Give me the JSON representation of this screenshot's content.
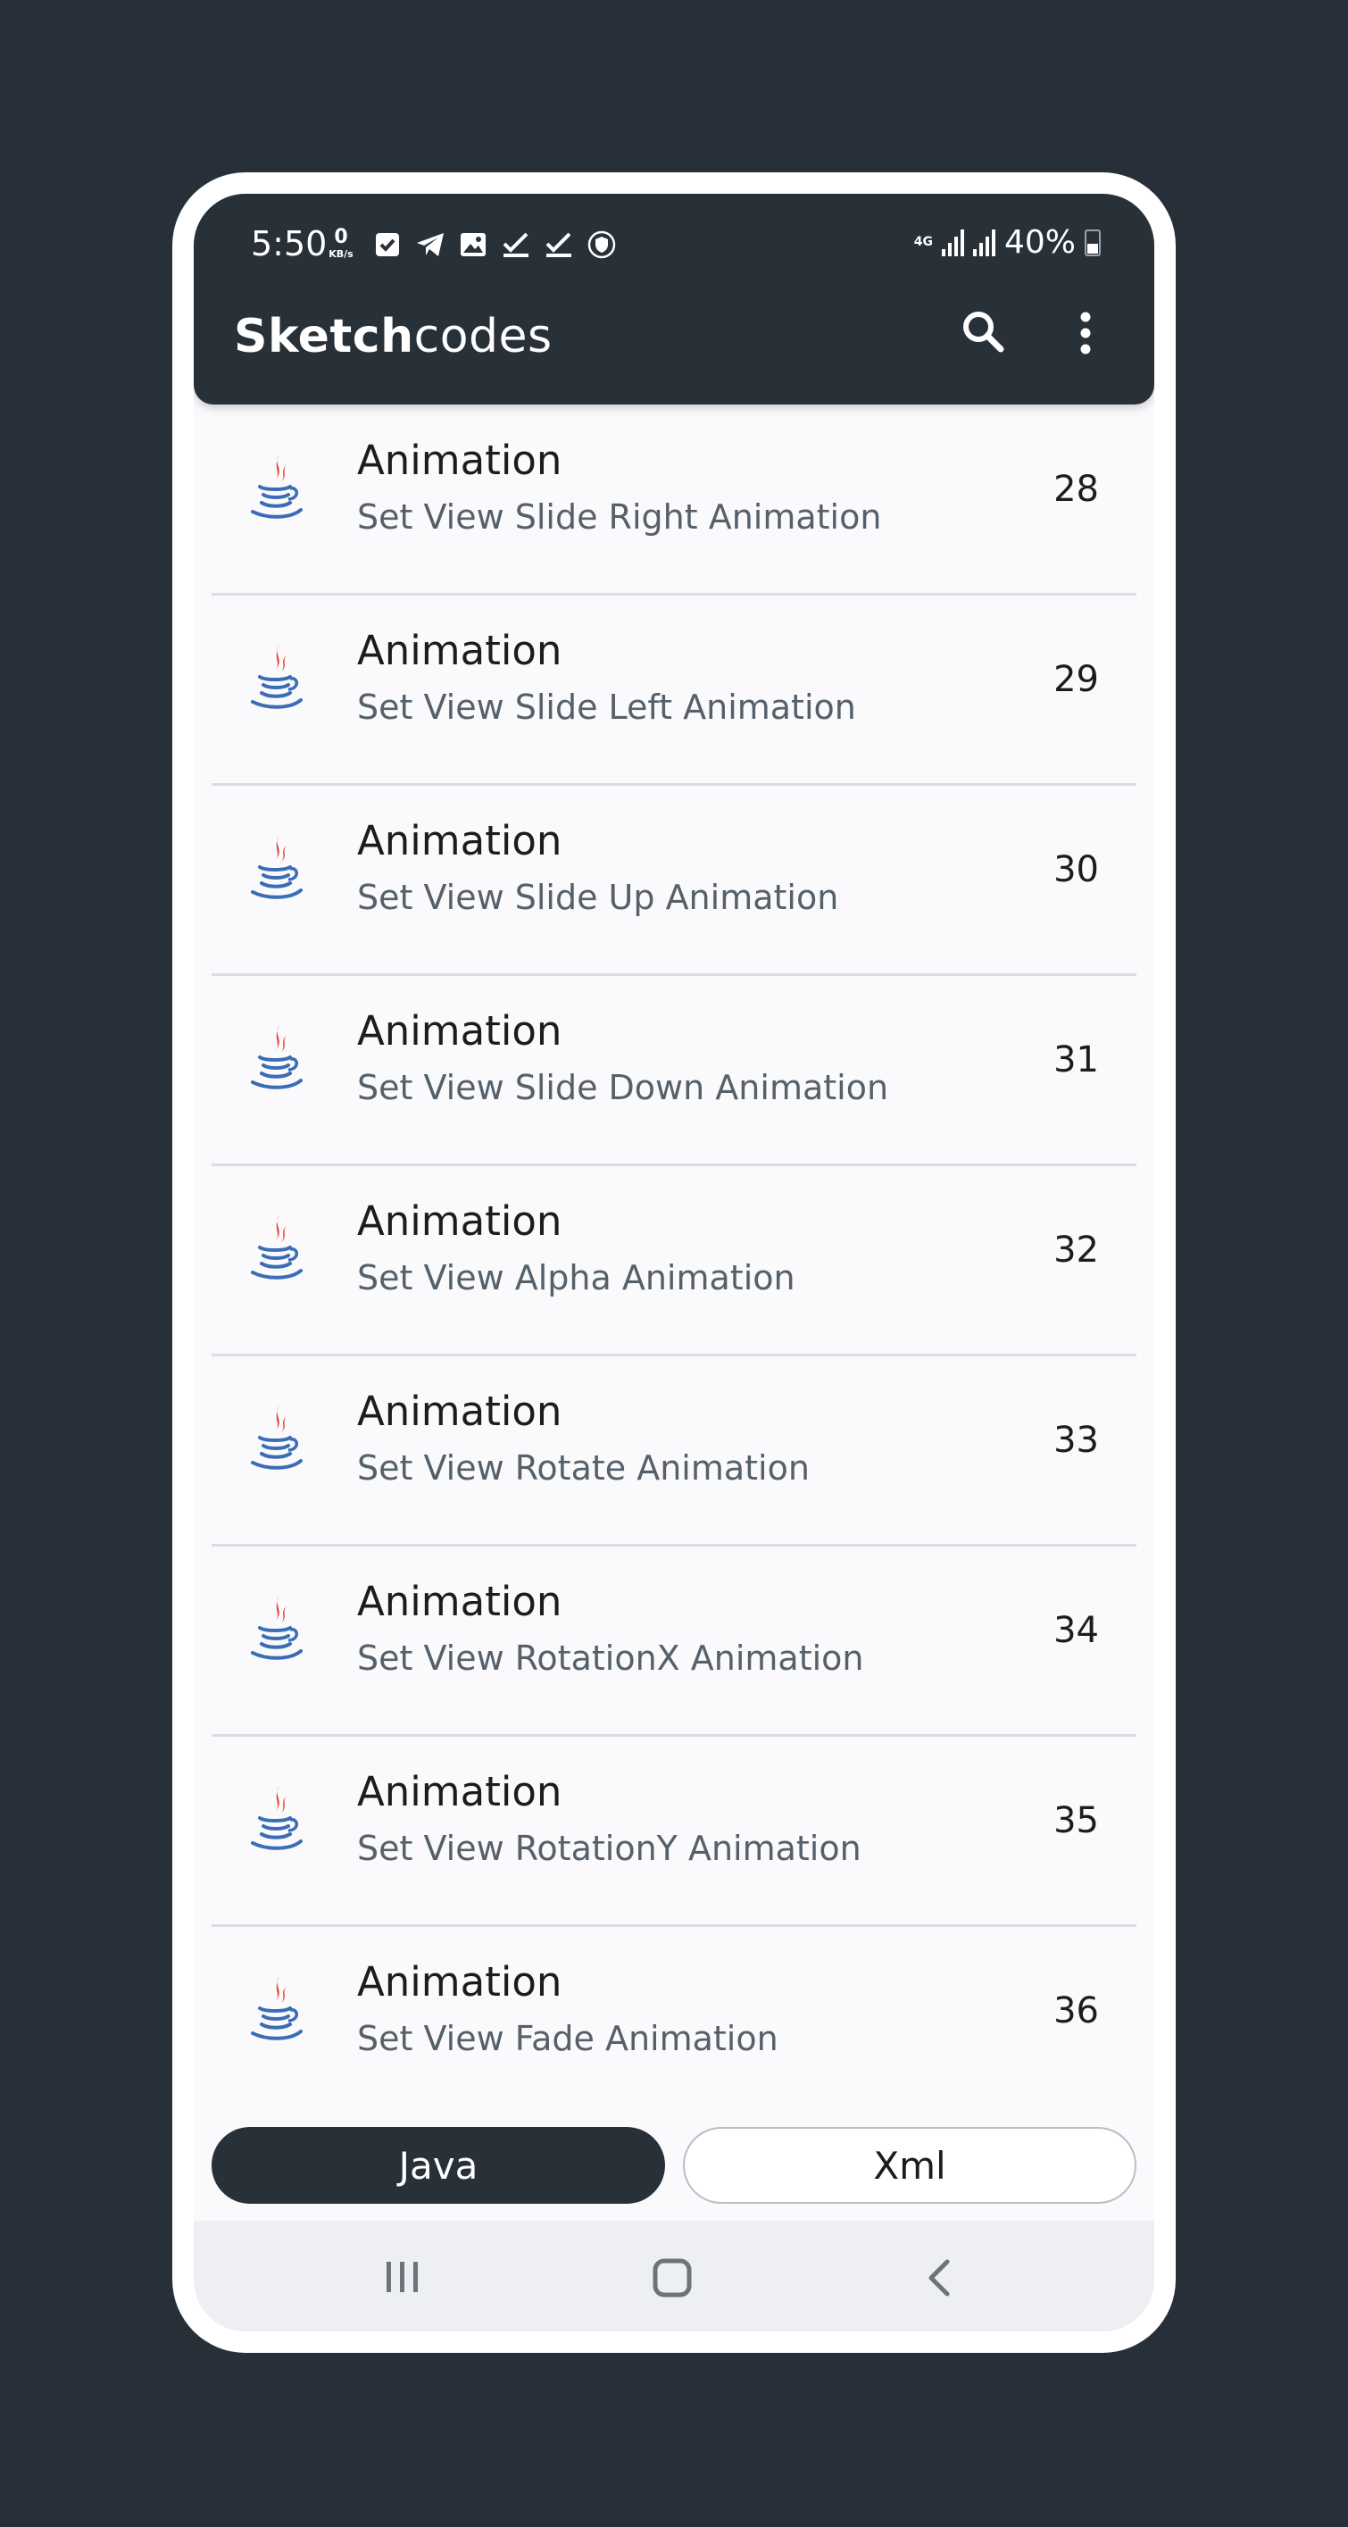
{
  "status_bar": {
    "time": "5:50",
    "net_speed_value": "0",
    "net_speed_unit": "KB/s",
    "network_type": "4G",
    "battery": "40%",
    "icons": [
      "checkbox-icon",
      "telegram-icon",
      "gallery-icon",
      "check-icon",
      "check-icon",
      "vpn-shield-icon"
    ]
  },
  "app_bar": {
    "title_bold": "Sketch",
    "title_regular": "codes"
  },
  "list": {
    "items": [
      {
        "title": "Animation",
        "subtitle": "Set View Slide Right Animation",
        "number": "28"
      },
      {
        "title": "Animation",
        "subtitle": "Set View Slide Left Animation",
        "number": "29"
      },
      {
        "title": "Animation",
        "subtitle": "Set View Slide Up Animation",
        "number": "30"
      },
      {
        "title": "Animation",
        "subtitle": "Set View Slide Down Animation",
        "number": "31"
      },
      {
        "title": "Animation",
        "subtitle": "Set View Alpha Animation",
        "number": "32"
      },
      {
        "title": "Animation",
        "subtitle": "Set View Rotate Animation",
        "number": "33"
      },
      {
        "title": "Animation",
        "subtitle": "Set View RotationX Animation",
        "number": "34"
      },
      {
        "title": "Animation",
        "subtitle": "Set View RotationY Animation",
        "number": "35"
      },
      {
        "title": "Animation",
        "subtitle": "Set View Fade Animation",
        "number": "36"
      }
    ]
  },
  "tabs": {
    "java_label": "Java",
    "xml_label": "Xml",
    "selected": "Java"
  },
  "colors": {
    "bar_bg": "#283038",
    "page_bg": "#272f38",
    "java_red": "#e0412f",
    "java_blue": "#3a6db5"
  }
}
